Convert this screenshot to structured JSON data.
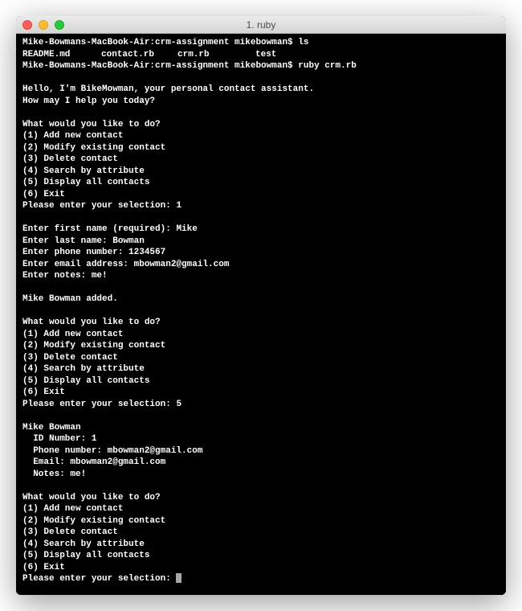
{
  "window": {
    "title": "1. ruby"
  },
  "prompt1": {
    "prefix": "Mike-Bowmans-MacBook-Air:crm-assignment mikebowman$ ",
    "cmd": "ls"
  },
  "ls_output": {
    "f1": "README.md",
    "f2": "contact.rb",
    "f3": "crm.rb",
    "f4": "test"
  },
  "prompt2": {
    "prefix": "Mike-Bowmans-MacBook-Air:crm-assignment mikebowman$ ",
    "cmd": "ruby crm.rb"
  },
  "greeting": {
    "l1": "Hello, I'm BikeMowman, your personal contact assistant.",
    "l2": "How may I help you today?"
  },
  "menu": {
    "header": "What would you like to do?",
    "opt1": "(1) Add new contact",
    "opt2": "(2) Modify existing contact",
    "opt3": "(3) Delete contact",
    "opt4": "(4) Search by attribute",
    "opt5": "(5) Display all contacts",
    "opt6": "(6) Exit",
    "prompt": "Please enter your selection: "
  },
  "sel1": "1",
  "add": {
    "first_label": "Enter first name (required): ",
    "first_val": "Mike",
    "last_label": "Enter last name: ",
    "last_val": "Bowman",
    "phone_label": "Enter phone number: ",
    "phone_val": "1234567",
    "email_label": "Enter email address: ",
    "email_val": "mbowman2@gmail.com",
    "notes_label": "Enter notes: ",
    "notes_val": "me!"
  },
  "added_msg": "Mike Bowman added.",
  "sel2": "5",
  "display": {
    "name": "Mike Bowman",
    "id": "  ID Number: 1",
    "phone": "  Phone number: mbowman2@gmail.com",
    "email": "  Email: mbowman2@gmail.com",
    "notes": "  Notes: me!"
  },
  "sel3": ""
}
